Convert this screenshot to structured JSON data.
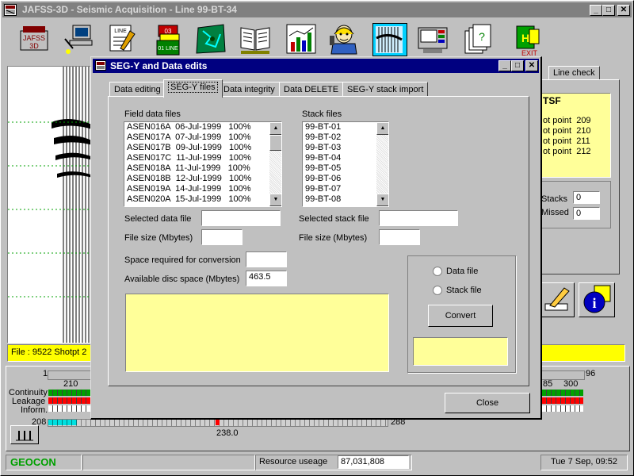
{
  "main_window": {
    "title": "JAFSS-3D - Seismic Acquisition - Line 99-BT-34",
    "app_icon": "jafss-logo-icon",
    "line_check_tab": "Line check",
    "right_panel_header": "TSF",
    "shotpoints": [
      "ot point  209",
      "ot point  210",
      "ot point  211",
      "ot point  212"
    ],
    "stacks_label": "Stacks",
    "stacks_value": "0",
    "missed_label": "Missed",
    "missed_value": "0",
    "file_status": "File : 9522  Shotpt 2",
    "scale_start": "1",
    "scale_end": "96",
    "tick_left": "210",
    "tick_right_a": "85",
    "tick_right_b": "300",
    "row_labels": [
      "Continuity",
      "Leakage",
      "Inform."
    ],
    "counter_left": "208",
    "counter_right": "288",
    "marker_value": "238.0",
    "colors": {
      "accent": "#000080",
      "yellow": "#ffff99",
      "bright_yellow": "#ffff00",
      "green": "#008000",
      "red": "#ff0000",
      "cyan": "#00e0e0"
    }
  },
  "toolbar": {
    "icons": [
      "jafss-3d-logo-icon",
      "computer-network-icon",
      "line-notepad-icon",
      "line-folders-icon",
      "map-icon",
      "book-icon",
      "chart-icon",
      "operator-phone-icon",
      "seismic-traces-icon",
      "monitor-panel-icon",
      "files-stack-icon",
      "exit-door-icon"
    ],
    "folder_label_top": "03",
    "folder_label_bottom": "01 LINE",
    "line_label": "LINE",
    "exit_label": "EXIT"
  },
  "status_bar": {
    "company": "GEOCON",
    "resource_label": "Resource useage",
    "resource_value": "87,031,808",
    "datetime": "Tue 7 Sep, 09:52"
  },
  "dialog": {
    "title": "SEG-Y and Data edits",
    "tabs": [
      "Data editing",
      "SEG-Y files",
      "Data integrity",
      "Data DELETE",
      "SEG-Y stack import"
    ],
    "active_tab": "SEG-Y files",
    "field_data_label": "Field data files",
    "field_files": [
      "ASEN016A  06-Jul-1999   100%",
      "ASEN017A  07-Jul-1999   100%",
      "ASEN017B  09-Jul-1999   100%",
      "ASEN017C  11-Jul-1999   100%",
      "ASEN018A  11-Jul-1999   100%",
      "ASEN018B  12-Jul-1999   100%",
      "ASEN019A  14-Jul-1999   100%",
      "ASEN020A  15-Jul-1999   100%"
    ],
    "stack_files_label": "Stack files",
    "stack_files": [
      "99-BT-01",
      "99-BT-02",
      "99-BT-03",
      "99-BT-04",
      "99-BT-05",
      "99-BT-06",
      "99-BT-07",
      "99-BT-08"
    ],
    "selected_data_label": "Selected data file",
    "selected_data_value": "",
    "file_size_label": "File size (Mbytes)",
    "file_size_value": "",
    "selected_stack_label": "Selected stack file",
    "selected_stack_value": "",
    "stack_size_label": "File size (Mbytes)",
    "stack_size_value": "",
    "space_required_label": "Space required for conversion",
    "space_required_value": "",
    "available_label": "Available disc space (Mbytes)",
    "available_value": "463.5",
    "radio_data": "Data file",
    "radio_stack": "Stack file",
    "convert_label": "Convert",
    "close_label": "Close"
  }
}
